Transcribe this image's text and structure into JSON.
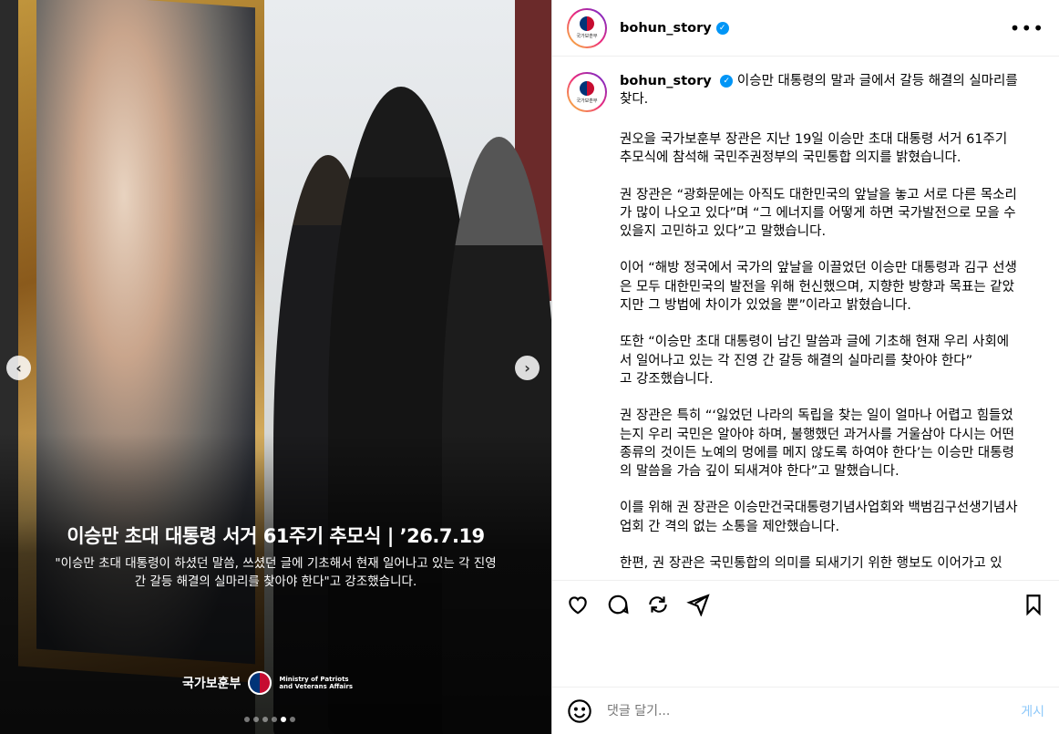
{
  "post": {
    "username": "bohun_story",
    "verified_icon": "verified-badge-icon",
    "more_icon": "more-options-icon",
    "avatar_text": "국가보훈부"
  },
  "media": {
    "title": "이승만 초대 대통령 서거 61주기 추모식 | ’26.7.19",
    "quote": "\"이승만 초대 대통령이 하셨던 말씀, 쓰셨던 글에 기초해서 현재 일어나고 있는 각 진영 간 갈등 해결의 실마리를 찾아야 한다\"고 강조했습니다.",
    "brand_ko": "국가보훈부",
    "brand_en": "Ministry of Patriots and Veterans Affairs",
    "prev_icon": "‹",
    "next_icon": "›",
    "slide_count": 6,
    "active_slide": 4
  },
  "caption": {
    "headline": "이승만 대통령의 말과 글에서 갈등 해결의 실마리를 찾다.",
    "paragraphs": [
      "권오을 국가보훈부 장관은 지난 19일 이승만 초대 대통령 서거 61주기 추모식에 참석해 국민주권정부의 국민통합 의지를 밝혔습니다.",
      "권 장관은 “광화문에는 아직도 대한민국의 앞날을 놓고 서로 다른 목소리가 많이 나오고 있다”며 “그 에너지를 어떻게 하면 국가발전으로 모을 수 있을지 고민하고 있다”고 말했습니다.",
      "이어 “해방 정국에서 국가의 앞날을 이끌었던 이승만 대통령과 김구 선생은 모두 대한민국의 발전을 위해 헌신했으며, 지향한 방향과 목표는 같았지만 그 방법에 차이가 있었을 뿐”이라고 밝혔습니다.",
      "또한 “이승만 초대 대통령이 남긴 말씀과 글에 기초해 현재 우리 사회에서 일어나고 있는 각 진영 간 갈등 해결의 실마리를 찾아야 한다”\n고 강조했습니다.",
      "권 장관은 특히 “‘잃었던 나라의 독립을 찾는 일이 얼마나 어렵고 힘들었는지 우리 국민은 알아야 하며, 불행했던 과거사를 거울삼아 다시는 어떤 종류의 것이든 노예의 멍에를 메지 않도록 하여야 한다’는 이승만 대통령의 말씀을 가슴 깊이 되새겨야 한다”고 말했습니다.",
      "이를 위해 권 장관은 이승만건국대통령기념사업회와 백범김구선생기념사업회 간 격의 없는 소통을 제안했습니다.",
      "한편, 권 장관은 국민통합의 의미를 되새기기 위한 행보도 이어가고 있"
    ]
  },
  "actions": {
    "like_icon": "heart-icon",
    "comment_icon": "comment-icon",
    "share_icon": "repost-icon",
    "send_icon": "send-icon",
    "save_icon": "bookmark-icon"
  },
  "comment_box": {
    "placeholder": "댓글 달기...",
    "post_label": "게시",
    "emoji_icon": "emoji-icon"
  },
  "colors": {
    "verified": "#0095f6",
    "post_button": "#8ec9fa",
    "placeholder": "#737373"
  }
}
